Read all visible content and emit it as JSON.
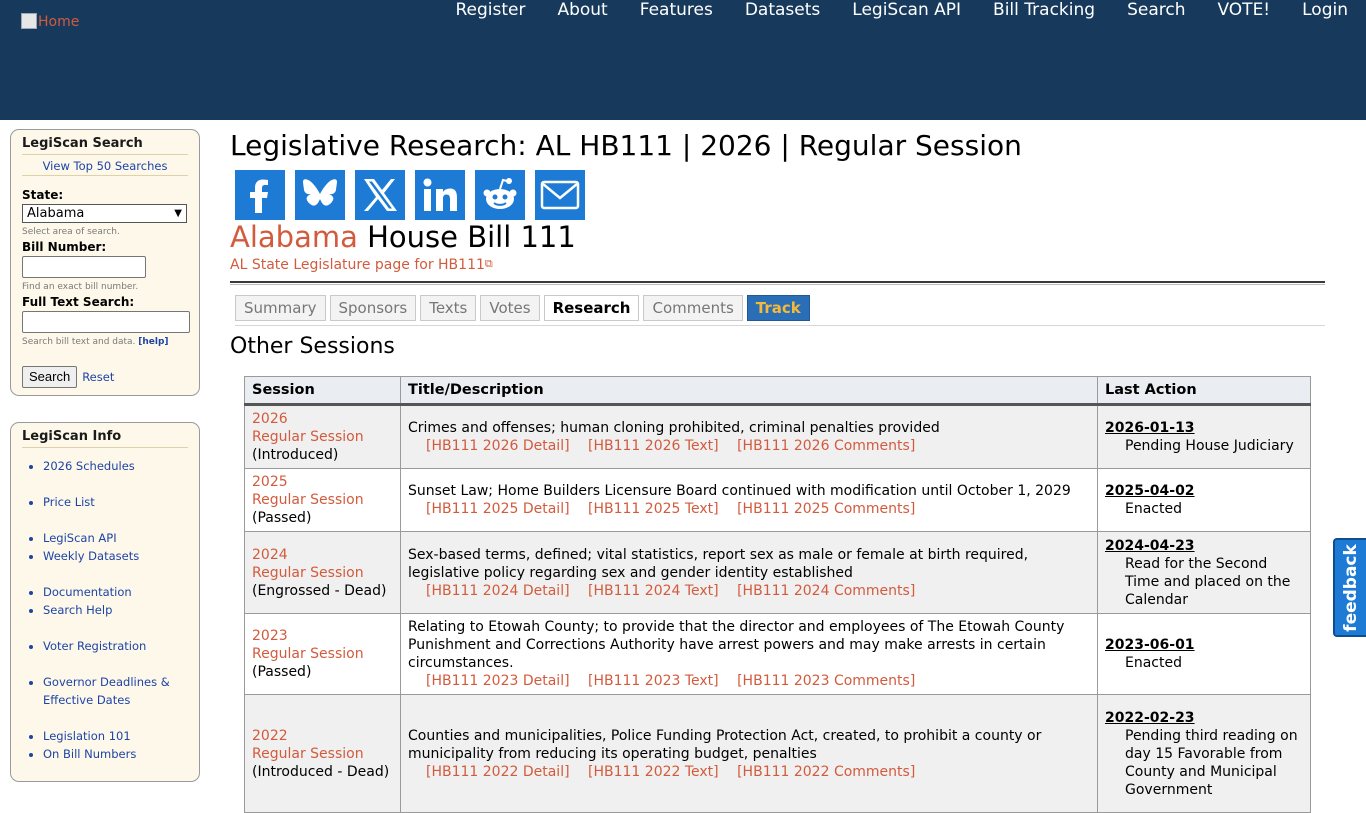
{
  "header": {
    "logo_alt": "Home",
    "nav": [
      "Register",
      "About",
      "Features",
      "Datasets",
      "LegiScan API",
      "Bill Tracking",
      "Search",
      "VOTE!",
      "Login"
    ]
  },
  "sidebar": {
    "search": {
      "title": "LegiScan Search",
      "top50": "View Top 50 Searches",
      "state_label": "State:",
      "state_value": "Alabama",
      "state_hint": "Select area of search.",
      "bill_label": "Bill Number:",
      "bill_value": "",
      "bill_hint": "Find an exact bill number.",
      "fulltext_label": "Full Text Search:",
      "fulltext_value": "",
      "fulltext_hint": "Search bill text and data.",
      "help": "[help]",
      "search_button": "Search",
      "reset": "Reset"
    },
    "info": {
      "title": "LegiScan Info",
      "items": [
        "2026 Schedules",
        "Price List",
        "LegiScan API",
        "Weekly Datasets",
        "Documentation",
        "Search Help",
        "Voter Registration",
        "Governor Deadlines & Effective Dates",
        "Legislation 101",
        "On Bill Numbers"
      ]
    }
  },
  "main": {
    "page_title": "Legislative Research: AL HB111 | 2026 | Regular Session",
    "share_icons": [
      "facebook-icon",
      "bluesky-icon",
      "x-icon",
      "linkedin-icon",
      "reddit-icon",
      "email-icon"
    ],
    "bill_state": "Alabama",
    "bill_name": "House Bill 111",
    "state_link": "AL State Legislature page for HB111",
    "tabs": [
      "Summary",
      "Sponsors",
      "Texts",
      "Votes",
      "Research",
      "Comments",
      "Track"
    ],
    "active_tab": "Research",
    "section_title": "Other Sessions",
    "table": {
      "headers": [
        "Session",
        "Title/Description",
        "Last Action"
      ],
      "rows": [
        {
          "year": "2026",
          "session": "Regular Session",
          "status": "(Introduced)",
          "title": "Crimes and offenses; human cloning prohibited, criminal penalties provided",
          "links": [
            "[HB111 2026 Detail]",
            "[HB111 2026 Text]",
            "[HB111 2026 Comments]"
          ],
          "date": "2026-01-13",
          "action": "Pending House Judiciary"
        },
        {
          "year": "2025",
          "session": "Regular Session",
          "status": "(Passed)",
          "title": "Sunset Law; Home Builders Licensure Board continued with modification until October 1, 2029",
          "links": [
            "[HB111 2025 Detail]",
            "[HB111 2025 Text]",
            "[HB111 2025 Comments]"
          ],
          "date": "2025-04-02",
          "action": "Enacted"
        },
        {
          "year": "2024",
          "session": "Regular Session",
          "status": "(Engrossed - Dead)",
          "title": "Sex-based terms, defined; vital statistics, report sex as male or female at birth required, legislative policy regarding sex and gender identity established",
          "links": [
            "[HB111 2024 Detail]",
            "[HB111 2024 Text]",
            "[HB111 2024 Comments]"
          ],
          "date": "2024-04-23",
          "action": "Read for the Second Time and placed on the Calendar"
        },
        {
          "year": "2023",
          "session": "Regular Session",
          "status": "(Passed)",
          "title": "Relating to Etowah County; to provide that the director and employees of The Etowah County Punishment and Corrections Authority have arrest powers and may make arrests in certain circumstances.",
          "links": [
            "[HB111 2023 Detail]",
            "[HB111 2023 Text]",
            "[HB111 2023 Comments]"
          ],
          "date": "2023-06-01",
          "action": "Enacted"
        },
        {
          "year": "2022",
          "session": "Regular Session",
          "status": "(Introduced - Dead)",
          "title": "Counties and municipalities, Police Funding Protection Act, created, to prohibit a county or municipality from reducing its operating budget, penalties",
          "links": [
            "[HB111 2022 Detail]",
            "[HB111 2022 Text]",
            "[HB111 2022 Comments]"
          ],
          "date": "2022-02-23",
          "action": "Pending third reading on day 15 Favorable from County and Municipal Government"
        }
      ]
    }
  },
  "feedback": "feedback"
}
